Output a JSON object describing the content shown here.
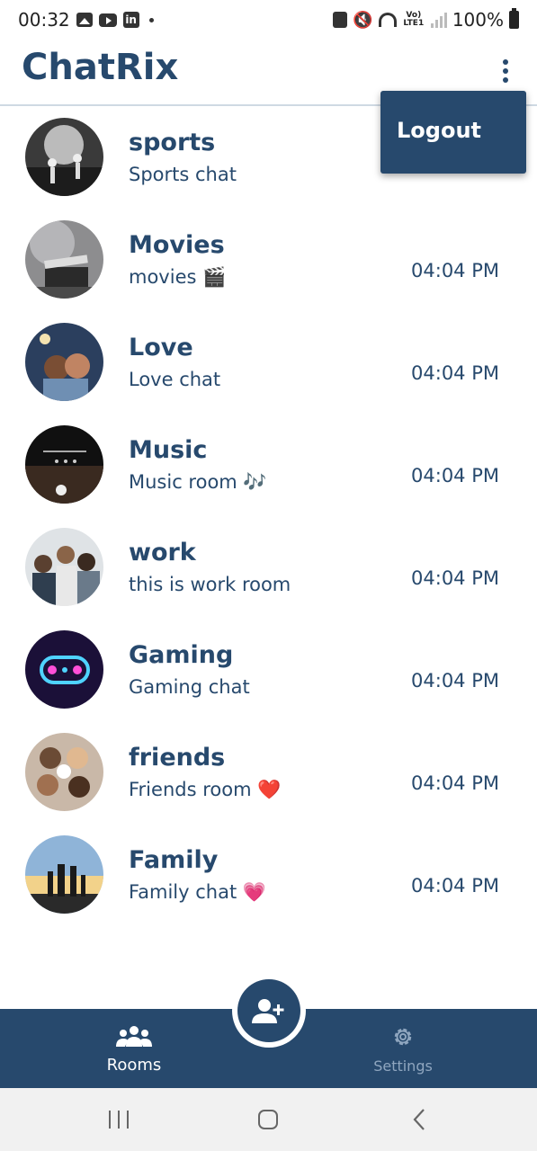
{
  "status_bar": {
    "time": "00:32",
    "network_label": "Vo) LTE1",
    "battery": "100%"
  },
  "app_bar": {
    "title": "ChatRix",
    "menu_icon": "more-vert-icon"
  },
  "menu": {
    "items": [
      {
        "label": "Logout"
      }
    ]
  },
  "rooms": [
    {
      "name": "sports",
      "subtitle": "Sports chat",
      "time": ""
    },
    {
      "name": "Movies",
      "subtitle": "movies 🎬",
      "time": "04:04 PM"
    },
    {
      "name": "Love",
      "subtitle": "Love chat",
      "time": "04:04 PM"
    },
    {
      "name": "Music",
      "subtitle": "Music room 🎶",
      "time": "04:04 PM"
    },
    {
      "name": "work",
      "subtitle": "this is work room",
      "time": "04:04 PM"
    },
    {
      "name": "Gaming",
      "subtitle": "Gaming chat",
      "time": "04:04 PM"
    },
    {
      "name": "friends",
      "subtitle": "Friends room ❤️",
      "time": "04:04 PM"
    },
    {
      "name": "Family",
      "subtitle": "Family chat 💗",
      "time": "04:04 PM"
    }
  ],
  "bottom_nav": {
    "items": [
      {
        "label": "Rooms",
        "icon": "group-icon",
        "active": true
      },
      {
        "label": "Settings",
        "icon": "gear-icon",
        "active": false
      }
    ],
    "fab_icon": "add-user-icon"
  },
  "colors": {
    "primary": "#27496d",
    "divider": "#cfd9e3",
    "inactive_nav": "#8fa6bf"
  }
}
